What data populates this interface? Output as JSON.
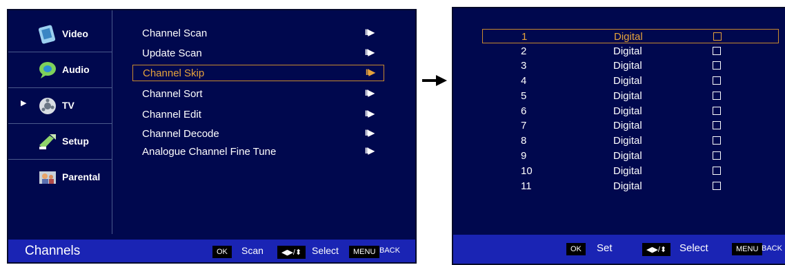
{
  "sidebar": {
    "items": [
      {
        "label": "Video",
        "icon": "video-icon"
      },
      {
        "label": "Audio",
        "icon": "audio-icon"
      },
      {
        "label": "TV",
        "icon": "tv-icon",
        "active": true
      },
      {
        "label": "Setup",
        "icon": "setup-icon"
      },
      {
        "label": "Parental",
        "icon": "parental-icon"
      }
    ],
    "active_marker": "▶"
  },
  "menu": {
    "items": [
      {
        "label": "Channel Scan",
        "arrow": "II▶"
      },
      {
        "label": "Update Scan",
        "arrow": "II▶"
      },
      {
        "label": "Channel Skip",
        "arrow": "II▶",
        "selected": true
      },
      {
        "label": "Channel Sort",
        "arrow": "II▶"
      },
      {
        "label": "Channel Edit",
        "arrow": "II▶"
      },
      {
        "label": "Channel Decode",
        "arrow": "II▶"
      },
      {
        "label": "Analogue Channel Fine Tune",
        "arrow": "II▶"
      }
    ]
  },
  "left_footer": {
    "title": "Channels",
    "ok_key": "OK",
    "ok_action": "Scan",
    "nav_key": "◀▶/⬍",
    "nav_action": "Select",
    "menu_key": "MENU",
    "menu_action": "BACK"
  },
  "channels": [
    {
      "number": "1",
      "type": "Digital",
      "selected": true
    },
    {
      "number": "2",
      "type": "Digital"
    },
    {
      "number": "3",
      "type": "Digital"
    },
    {
      "number": "4",
      "type": "Digital"
    },
    {
      "number": "5",
      "type": "Digital"
    },
    {
      "number": "6",
      "type": "Digital"
    },
    {
      "number": "7",
      "type": "Digital"
    },
    {
      "number": "8",
      "type": "Digital"
    },
    {
      "number": "9",
      "type": "Digital"
    },
    {
      "number": "10",
      "type": "Digital"
    },
    {
      "number": "11",
      "type": "Digital"
    }
  ],
  "right_footer": {
    "ok_key": "OK",
    "ok_action": "Set",
    "nav_key": "◀▶/⬍",
    "nav_action": "Select",
    "menu_key": "MENU",
    "menu_action": "BACK"
  },
  "colors": {
    "panel_bg": "#00084e",
    "footer_bg": "#1a24b4",
    "highlight": "#e6a23c"
  }
}
